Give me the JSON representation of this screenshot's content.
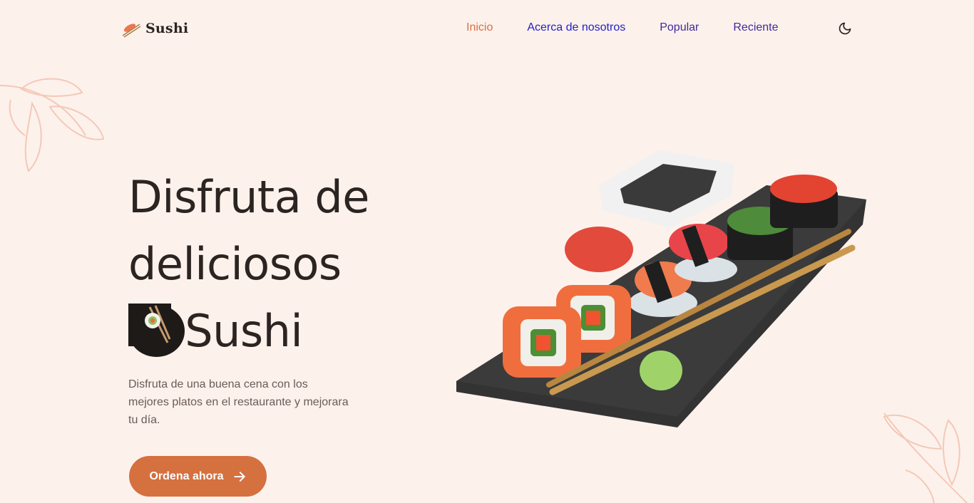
{
  "brand": {
    "name": "Sushi"
  },
  "nav": {
    "items": [
      {
        "label": "Inicio",
        "active": true
      },
      {
        "label": "Acerca de nosotros",
        "active": false
      },
      {
        "label": "Popular",
        "active": false
      },
      {
        "label": "Reciente",
        "active": false
      }
    ],
    "theme_icon": "moon-icon"
  },
  "hero": {
    "title_line1": "Disfruta de",
    "title_line2": "deliciosos",
    "title_line3": "Sushi",
    "description": "Disfruta de una buena cena con los mejores platos en el restaurante y mejorara tu día.",
    "cta_label": "Ordena ahora",
    "cta_icon": "arrow-right-icon"
  },
  "colors": {
    "background": "#fdf1ec",
    "accent": "#d5703f",
    "nav_text": "#3e2b9a",
    "nav_active": "#d77044",
    "title": "#2b2421"
  }
}
